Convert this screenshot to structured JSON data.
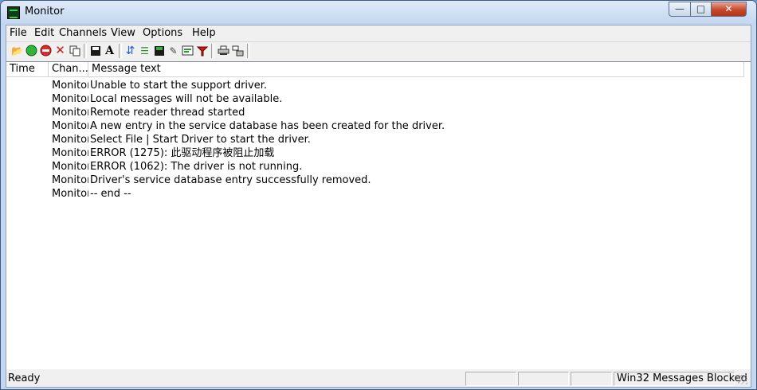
{
  "window": {
    "title": "Monitor"
  },
  "menu": [
    "File",
    "Edit",
    "Channels",
    "View",
    "Options",
    "Help"
  ],
  "toolbar_icons": [
    "open-icon",
    "start-icon",
    "stop-icon",
    "clear-icon",
    "copy-icon",
    "save-icon",
    "font-icon",
    "autoscroll-icon",
    "find-icon",
    "save-log-icon",
    "highlight-icon",
    "filter-list-icon",
    "filter-icon",
    "print-icon",
    "print-setup-icon"
  ],
  "columns": [
    "Time",
    "Chan...",
    "Message text"
  ],
  "rows": [
    {
      "time": "",
      "channel": "Monitor",
      "message": "Unable to start the support driver."
    },
    {
      "time": "",
      "channel": "Monitor",
      "message": "Local messages will not be available."
    },
    {
      "time": "",
      "channel": "Monitor",
      "message": "Remote reader thread started"
    },
    {
      "time": "",
      "channel": "Monitor",
      "message": "A new entry in the service database has been created for the driver."
    },
    {
      "time": "",
      "channel": "Monitor",
      "message": "Select File | Start Driver to start the driver."
    },
    {
      "time": "",
      "channel": "Monitor",
      "message": "ERROR (1275): 此驱动程序被阻止加载"
    },
    {
      "time": "",
      "channel": "Monitor",
      "message": "ERROR (1062): The driver is not running."
    },
    {
      "time": "",
      "channel": "Monitor",
      "message": "Driver's service database entry successfully removed."
    },
    {
      "time": "",
      "channel": "Monitor",
      "message": " -- end --"
    }
  ],
  "status": {
    "ready": "Ready",
    "panel_right": "Win32 Messages Blocked"
  }
}
